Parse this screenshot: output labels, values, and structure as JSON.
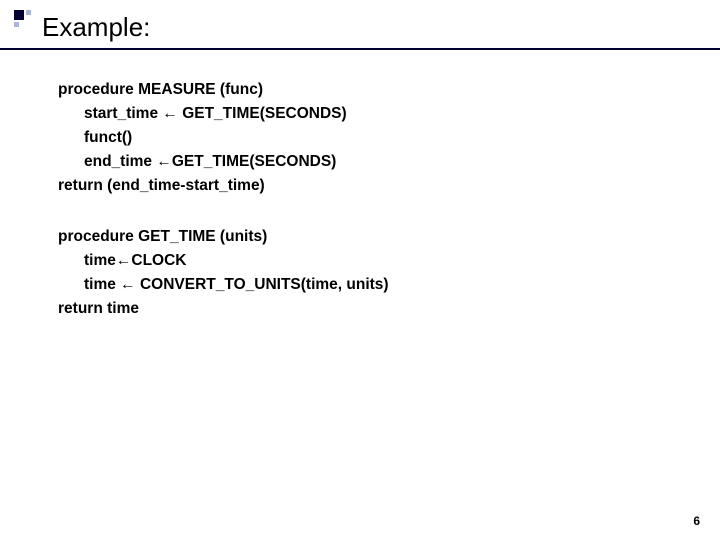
{
  "heading": "Example:",
  "block1": {
    "l1_a": "procedure",
    "l1_b": " MEASURE (func)",
    "l2": "start_time ← GET_TIME(SECONDS)",
    "l3": "funct()",
    "l4": "end_time ←GET_TIME(SECONDS)",
    "l5_a": "return",
    "l5_b": " (end_time-start_time)"
  },
  "block2": {
    "l1_a": "procedure",
    "l1_b": " GET_TIME (units)",
    "l2": "time←CLOCK",
    "l3": "time ← CONVERT_TO_UNITS(time, units)",
    "l4_a": "return",
    "l4_b": " time"
  },
  "page_number": "6"
}
